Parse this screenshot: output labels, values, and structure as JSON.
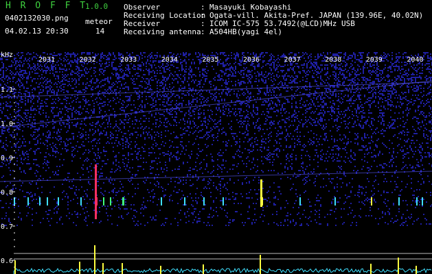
{
  "header": {
    "app_title": "H R O F F T",
    "version": "1.0.0",
    "filename": "0402132030.png",
    "meteor_label": "meteor",
    "meteor_count": "14",
    "datetime": "04.02.13 20:30",
    "info": [
      {
        "key": "Observer",
        "sep": ":",
        "value": "Masayuki Kobayashi"
      },
      {
        "key": "Receiving Location",
        "sep": ":",
        "value": "Ogata-vill. Akita-Pref. JAPAN (139.96E, 40.02N)"
      },
      {
        "key": "Receiver",
        "sep": ":",
        "value": "ICOM IC-575 53.7492(@LCD)MHz USB"
      },
      {
        "key": "Receiving antenna",
        "sep": ":",
        "value": "A504HB(yagi 4el)"
      }
    ]
  },
  "spectrogram": {
    "y_unit": "kHz",
    "y_ticks": [
      "1.1",
      "1.0",
      "0.9",
      "0.8",
      "0.7",
      "0.6"
    ],
    "y_values": [
      1.1,
      1.0,
      0.9,
      0.8,
      0.7,
      0.6
    ],
    "minute_labels": [
      "2031",
      "2032",
      "2033",
      "2034",
      "2035",
      "2036",
      "2037",
      "2038",
      "2039",
      "2040"
    ],
    "colors": {
      "background": "#000000",
      "noise": "#2a2ad8",
      "label": "#ffffff",
      "echo_hot": "#ff3060",
      "echo_warm": "#ffff40",
      "echo_cool": "#40ff80",
      "signal": "#40e0ff"
    }
  }
}
